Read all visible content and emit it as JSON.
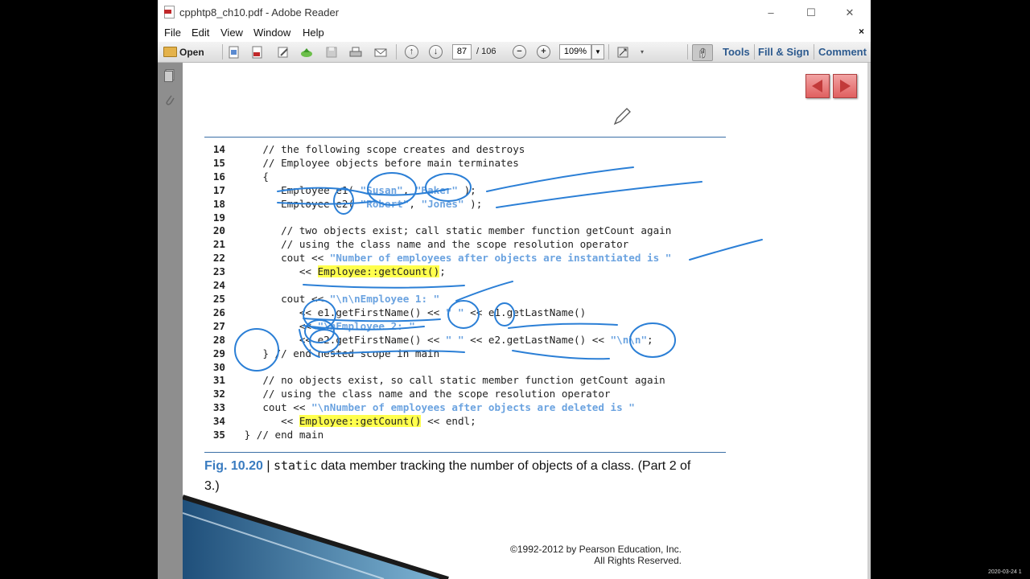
{
  "window": {
    "title": "cpphtp8_ch10.pdf - Adobe Reader",
    "controls": {
      "minimize": "–",
      "maximize": "☐",
      "close": "✕"
    }
  },
  "menu": {
    "items": [
      "File",
      "Edit",
      "View",
      "Window",
      "Help"
    ],
    "close": "×"
  },
  "toolbar": {
    "open_label": "Open",
    "page_current": "87",
    "page_total": "/ 106",
    "zoom": "109%",
    "tools_label": "Tools",
    "fill_sign_label": "Fill & Sign",
    "comment_label": "Comment"
  },
  "code_lines": [
    {
      "num": "14",
      "text": "    // the following scope creates and destroys"
    },
    {
      "num": "15",
      "text": "    // Employee objects before main terminates"
    },
    {
      "num": "16",
      "text": "    {"
    },
    {
      "num": "17",
      "text": "       Employee e1( \"Susan\", \"Baker\" );"
    },
    {
      "num": "18",
      "text": "       Employee e2( \"Robert\", \"Jones\" );"
    },
    {
      "num": "19",
      "text": ""
    },
    {
      "num": "20",
      "text": "       // two objects exist; call static member function getCount again"
    },
    {
      "num": "21",
      "text": "       // using the class name and the scope resolution operator"
    },
    {
      "num": "22",
      "text": "       cout << \"Number of employees after objects are instantiated is \""
    },
    {
      "num": "23",
      "text": "          << Employee::getCount();"
    },
    {
      "num": "24",
      "text": ""
    },
    {
      "num": "25",
      "text": "       cout << \"\\n\\nEmployee 1: \""
    },
    {
      "num": "26",
      "text": "          << e1.getFirstName() << \" \" << e1.getLastName()"
    },
    {
      "num": "27",
      "text": "          << \"\\nEmployee 2: \""
    },
    {
      "num": "28",
      "text": "          << e2.getFirstName() << \" \" << e2.getLastName() << \"\\n\\n\";"
    },
    {
      "num": "29",
      "text": "    } // end nested scope in main"
    },
    {
      "num": "30",
      "text": ""
    },
    {
      "num": "31",
      "text": "    // no objects exist, so call static member function getCount again"
    },
    {
      "num": "32",
      "text": "    // using the class name and the scope resolution operator"
    },
    {
      "num": "33",
      "text": "    cout << \"\\nNumber of employees after objects are deleted is \""
    },
    {
      "num": "34",
      "text": "       << Employee::getCount() << endl;"
    },
    {
      "num": "35",
      "text": " } // end main"
    }
  ],
  "caption": {
    "fig": "Fig. 10.20",
    "sep": " | ",
    "mono": "static",
    "text": " data member tracking the number of objects of a class. (Part 2 of 3.)"
  },
  "copyright": {
    "line1": "©1992-2012 by Pearson Education, Inc.",
    "line2": "All Rights Reserved."
  },
  "timestamp": "2020-03-24 1"
}
